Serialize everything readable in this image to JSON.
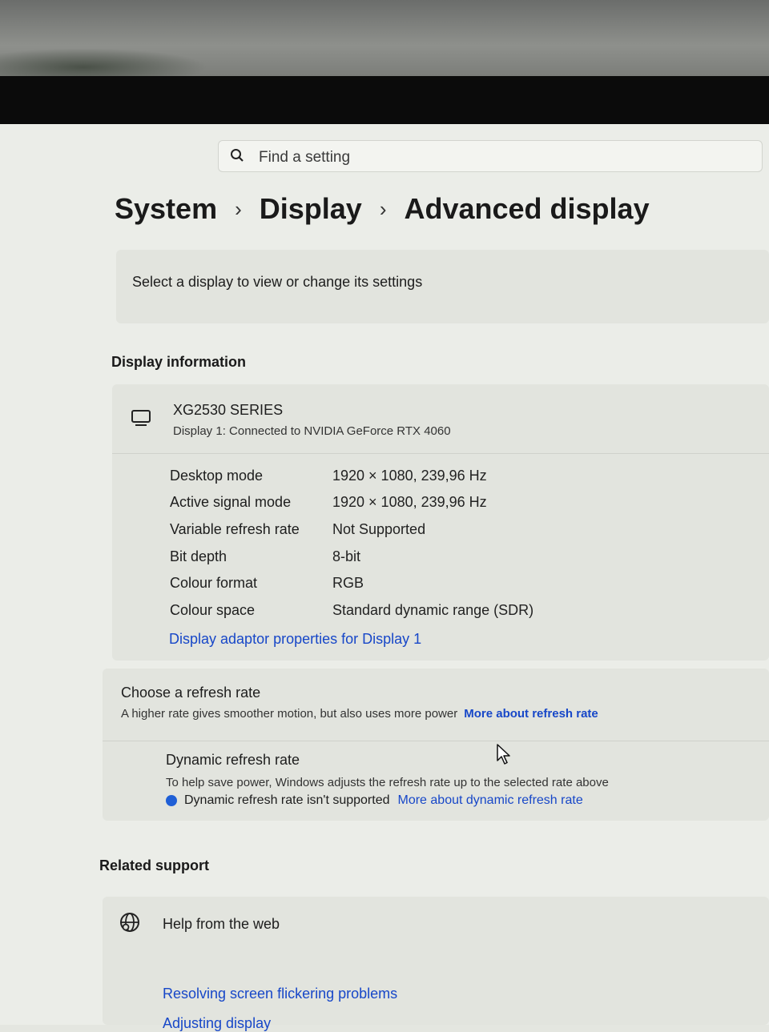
{
  "search": {
    "placeholder": "Find a setting"
  },
  "breadcrumb": {
    "items": [
      "System",
      "Display",
      "Advanced display"
    ]
  },
  "select_display": {
    "text": "Select a display to view or change its settings"
  },
  "display_information": {
    "title": "Display information",
    "monitor_name": "XG2530 SERIES",
    "monitor_sub": "Display 1: Connected to NVIDIA GeForce RTX 4060",
    "rows": [
      {
        "label": "Desktop mode",
        "value": "1920 × 1080, 239,96 Hz"
      },
      {
        "label": "Active signal mode",
        "value": "1920 × 1080, 239,96 Hz"
      },
      {
        "label": "Variable refresh rate",
        "value": "Not Supported"
      },
      {
        "label": "Bit depth",
        "value": "8-bit"
      },
      {
        "label": "Colour format",
        "value": "RGB"
      },
      {
        "label": "Colour space",
        "value": "Standard dynamic range (SDR)"
      }
    ],
    "adaptor_link": "Display adaptor properties for Display 1"
  },
  "refresh": {
    "title": "Choose a refresh rate",
    "subtitle": "A higher rate gives smoother motion, but also uses more power",
    "more_link": "More about refresh rate",
    "dynamic_title": "Dynamic refresh rate",
    "dynamic_sub": "To help save power, Windows adjusts the refresh rate up to the selected rate above",
    "dynamic_note": "Dynamic refresh rate isn't supported",
    "dynamic_link": "More about dynamic refresh rate"
  },
  "related_support": {
    "title": "Related support",
    "help": "Help from the web",
    "link_flicker": "Resolving screen flickering problems",
    "link_adjust": "Adjusting display"
  },
  "colors": {
    "link": "#1747c8",
    "info_dot": "#1f5fd6"
  }
}
